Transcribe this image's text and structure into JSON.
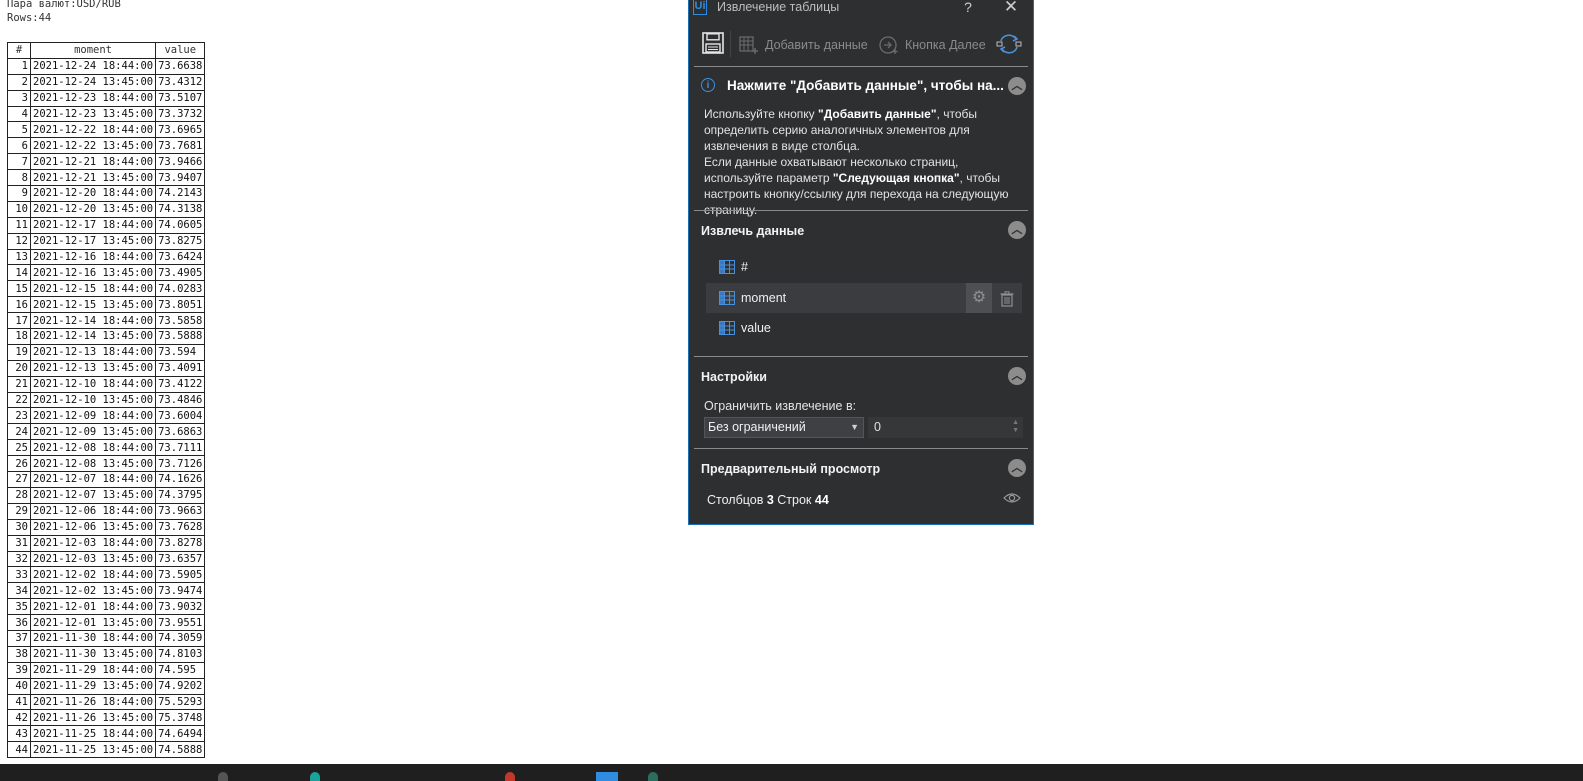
{
  "page": {
    "pair_label": "Пара валют:USD/RUB",
    "rows_label": "Rows:44"
  },
  "table": {
    "headers": [
      "#",
      "moment",
      "value"
    ],
    "rows": [
      [
        "1",
        "2021-12-24 18:44:00",
        "73.6638"
      ],
      [
        "2",
        "2021-12-24 13:45:00",
        "73.4312"
      ],
      [
        "3",
        "2021-12-23 18:44:00",
        "73.5107"
      ],
      [
        "4",
        "2021-12-23 13:45:00",
        "73.3732"
      ],
      [
        "5",
        "2021-12-22 18:44:00",
        "73.6965"
      ],
      [
        "6",
        "2021-12-22 13:45:00",
        "73.7681"
      ],
      [
        "7",
        "2021-12-21 18:44:00",
        "73.9466"
      ],
      [
        "8",
        "2021-12-21 13:45:00",
        "73.9407"
      ],
      [
        "9",
        "2021-12-20 18:44:00",
        "74.2143"
      ],
      [
        "10",
        "2021-12-20 13:45:00",
        "74.3138"
      ],
      [
        "11",
        "2021-12-17 18:44:00",
        "74.0605"
      ],
      [
        "12",
        "2021-12-17 13:45:00",
        "73.8275"
      ],
      [
        "13",
        "2021-12-16 18:44:00",
        "73.6424"
      ],
      [
        "14",
        "2021-12-16 13:45:00",
        "73.4905"
      ],
      [
        "15",
        "2021-12-15 18:44:00",
        "74.0283"
      ],
      [
        "16",
        "2021-12-15 13:45:00",
        "73.8051"
      ],
      [
        "17",
        "2021-12-14 18:44:00",
        "73.5858"
      ],
      [
        "18",
        "2021-12-14 13:45:00",
        "73.5888"
      ],
      [
        "19",
        "2021-12-13 18:44:00",
        "73.594"
      ],
      [
        "20",
        "2021-12-13 13:45:00",
        "73.4091"
      ],
      [
        "21",
        "2021-12-10 18:44:00",
        "73.4122"
      ],
      [
        "22",
        "2021-12-10 13:45:00",
        "73.4846"
      ],
      [
        "23",
        "2021-12-09 18:44:00",
        "73.6004"
      ],
      [
        "24",
        "2021-12-09 13:45:00",
        "73.6863"
      ],
      [
        "25",
        "2021-12-08 18:44:00",
        "73.7111"
      ],
      [
        "26",
        "2021-12-08 13:45:00",
        "73.7126"
      ],
      [
        "27",
        "2021-12-07 18:44:00",
        "74.1626"
      ],
      [
        "28",
        "2021-12-07 13:45:00",
        "74.3795"
      ],
      [
        "29",
        "2021-12-06 18:44:00",
        "73.9663"
      ],
      [
        "30",
        "2021-12-06 13:45:00",
        "73.7628"
      ],
      [
        "31",
        "2021-12-03 18:44:00",
        "73.8278"
      ],
      [
        "32",
        "2021-12-03 13:45:00",
        "73.6357"
      ],
      [
        "33",
        "2021-12-02 18:44:00",
        "73.5905"
      ],
      [
        "34",
        "2021-12-02 13:45:00",
        "73.9474"
      ],
      [
        "35",
        "2021-12-01 18:44:00",
        "73.9032"
      ],
      [
        "36",
        "2021-12-01 13:45:00",
        "73.9551"
      ],
      [
        "37",
        "2021-11-30 18:44:00",
        "74.3059"
      ],
      [
        "38",
        "2021-11-30 13:45:00",
        "74.8103"
      ],
      [
        "39",
        "2021-11-29 18:44:00",
        "74.595"
      ],
      [
        "40",
        "2021-11-29 13:45:00",
        "74.9202"
      ],
      [
        "41",
        "2021-11-26 18:44:00",
        "75.5293"
      ],
      [
        "42",
        "2021-11-26 13:45:00",
        "75.3748"
      ],
      [
        "43",
        "2021-11-25 18:44:00",
        "74.6494"
      ],
      [
        "44",
        "2021-11-25 13:45:00",
        "74.5888"
      ]
    ]
  },
  "panel": {
    "logo_text": "Ui",
    "title": "Извлечение таблицы",
    "help_glyph": "?",
    "close_glyph": "✕",
    "toolbar": {
      "add_data_label": "Добавить данные",
      "next_button_label": "Кнопка Далее"
    },
    "info": {
      "title": "Нажмите \"Добавить данные\", чтобы на...",
      "line1_pre": "Используйте кнопку ",
      "line1_bold": "\"Добавить данные\"",
      "line1_post": ", чтобы определить серию аналогичных элементов для извлечения в виде столбца.",
      "line2": "Если данные охватывают несколько страниц, используйте параметр ",
      "line2_bold": "\"Следующая кнопка\"",
      "line2_post": ", чтобы настроить кнопку/ссылку для перехода на следующую страницу."
    },
    "extract": {
      "title": "Извлечь данные",
      "columns": [
        "#",
        "moment",
        "value"
      ]
    },
    "settings": {
      "title": "Настройки",
      "limit_label": "Ограничить извлечение в:",
      "limit_option": "Без ограничений",
      "limit_value": "0"
    },
    "preview": {
      "title": "Предварительный просмотр",
      "columns_label": "Столбцов",
      "columns_count": "3",
      "rows_label": "Строк",
      "rows_count": "44"
    }
  },
  "colors": {
    "panel_bg": "#2e2f31",
    "accent": "#2f8ce0",
    "taskbar": "#1f1f1f"
  }
}
